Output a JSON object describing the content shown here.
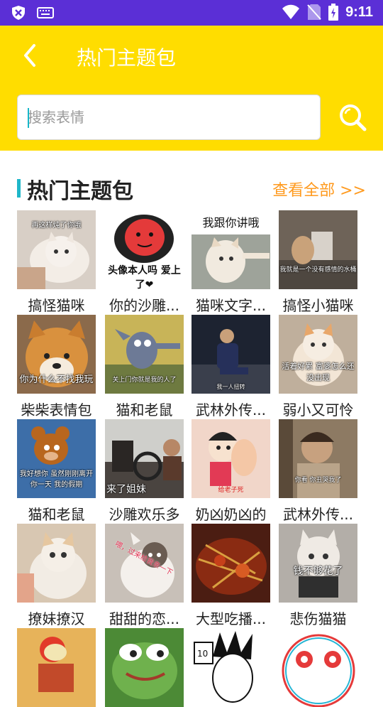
{
  "status_bar": {
    "time": "9:11"
  },
  "header": {
    "title": "热门主题包"
  },
  "search": {
    "placeholder": "搜索表情"
  },
  "section": {
    "title": "热门主题包",
    "see_all": "查看全部 >>"
  },
  "items": [
    {
      "label": "搞怪猫咪",
      "caption": "再这样炖了你哦"
    },
    {
      "label": "你的沙雕...",
      "caption": "头像本人吗 爱上了❤"
    },
    {
      "label": "猫咪文字...",
      "caption": "我跟你讲哦"
    },
    {
      "label": "搞怪小猫咪",
      "caption": "我就是一个没有感情的水桶"
    },
    {
      "label": "柴柴表情包",
      "caption": "你为什么不找我玩"
    },
    {
      "label": "猫和老鼠",
      "caption": "关上门你就是我的人了"
    },
    {
      "label": "武林外传...",
      "caption": "我一人扭转"
    },
    {
      "label": "弱小又可怜",
      "caption": "活着好累 富婆怎么还没出现"
    },
    {
      "label": "猫和老鼠",
      "caption": "我好想你 虽然刚刚离开你一天 我的假期"
    },
    {
      "label": "沙雕欢乐多",
      "caption": "来了姐妹"
    },
    {
      "label": "奶凶奶凶的",
      "caption": "给老子死"
    },
    {
      "label": "武林外传...",
      "caption": "你看 你丑哭我了"
    },
    {
      "label": "撩妹撩汉",
      "caption": ""
    },
    {
      "label": "甜甜的恋...",
      "caption": "喂，过来给我亲一下"
    },
    {
      "label": "大型吃播...",
      "caption": ""
    },
    {
      "label": "悲伤猫猫",
      "caption": "钱不够花了"
    },
    {
      "label": "",
      "caption": ""
    },
    {
      "label": "",
      "caption": ""
    },
    {
      "label": "",
      "caption": ""
    },
    {
      "label": "",
      "caption": ""
    }
  ],
  "colors": {
    "status_bar": "#5b2fd6",
    "header": "#ffdd00",
    "accent": "#1fb7c9",
    "see_all": "#ff9a1e"
  }
}
